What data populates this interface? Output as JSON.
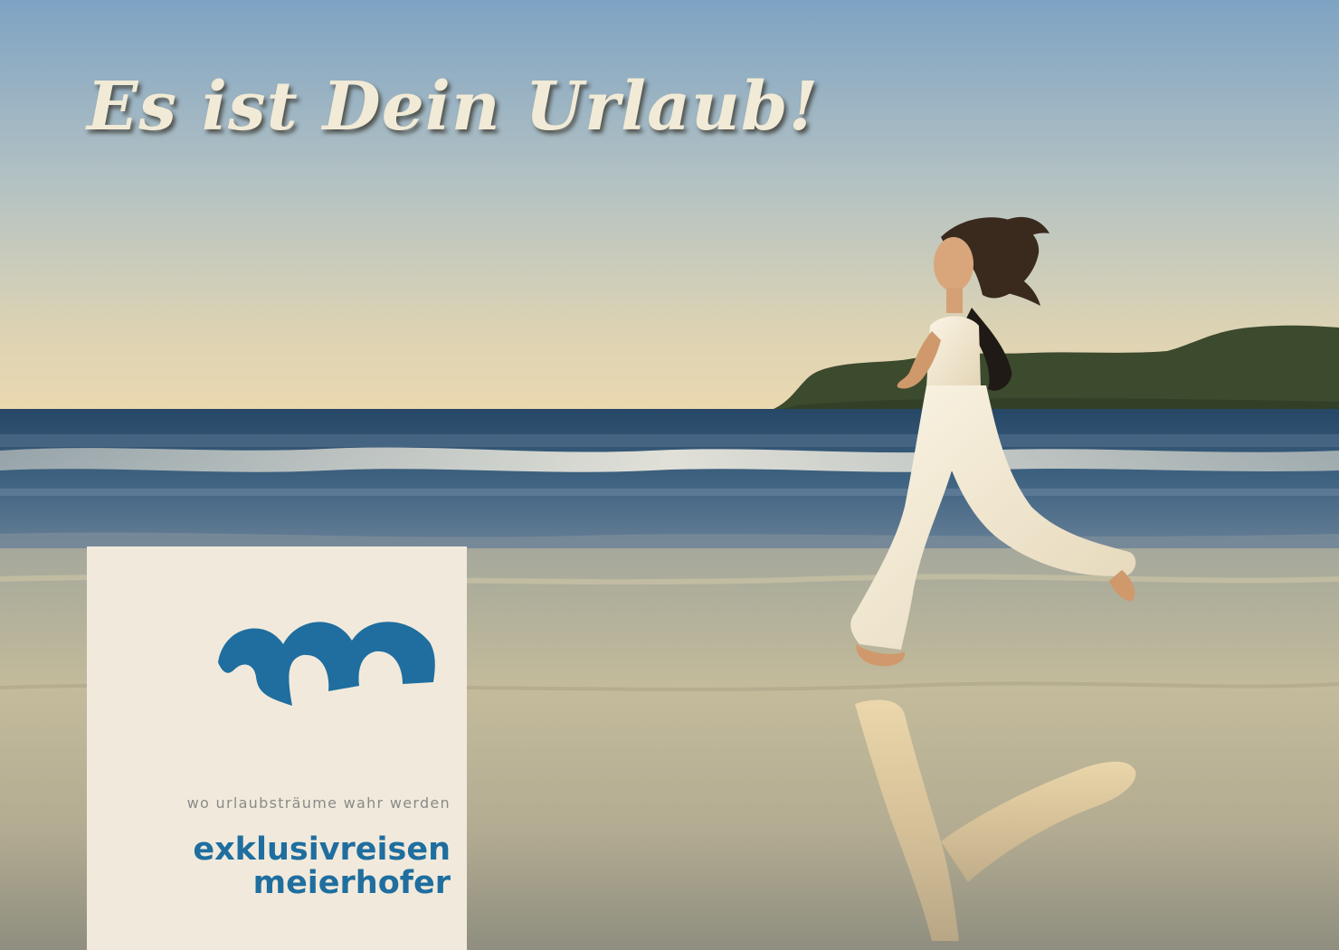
{
  "headline": "Es ist Dein Urlaub!",
  "logo": {
    "tagline": "wo urlaubsträume wahr werden",
    "brand_line_1": "exklusivreisen",
    "brand_line_2": "meierhofer",
    "mark_icon": "m-wave-logo-icon",
    "brand_color": "#1f6e9f",
    "card_color": "#f1eadc"
  },
  "colors": {
    "sky_top": "#86a7c2",
    "sky_horizon": "#e9d9b4",
    "sea": "#2e4e6e",
    "sand": "#b9b59c",
    "headline": "#f1ead6"
  }
}
